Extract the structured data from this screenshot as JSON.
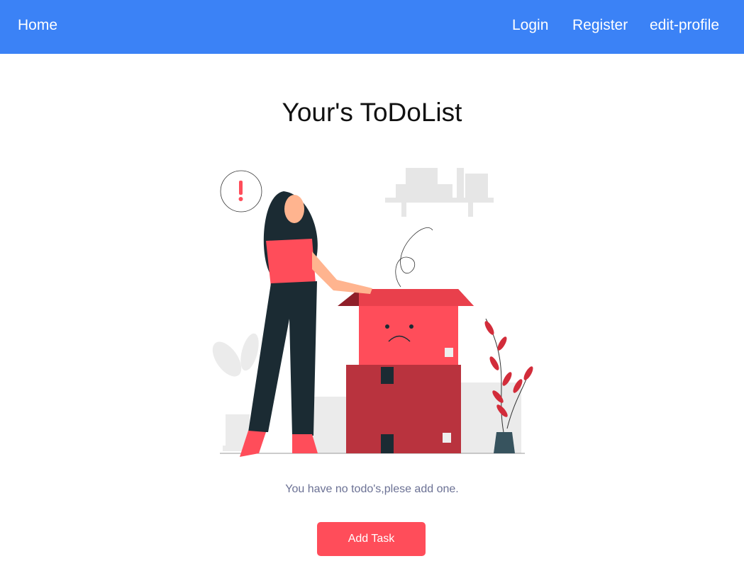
{
  "nav": {
    "home": "Home",
    "login": "Login",
    "register": "Register",
    "edit_profile": "edit-profile"
  },
  "main": {
    "title": "Your's ToDoList",
    "empty_message": "You have no todo's,plese add one.",
    "add_task_label": "Add Task"
  },
  "colors": {
    "nav": "#3b82f6",
    "accent": "#ff4d5a",
    "message": "#6b7194"
  }
}
